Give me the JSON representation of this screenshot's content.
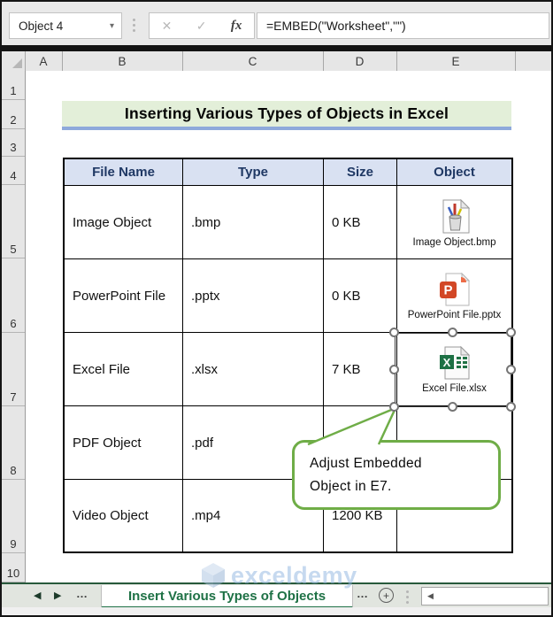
{
  "formula_bar": {
    "name_box_value": "Object 4",
    "name_box_dropdown_glyph": "▾",
    "cancel_glyph": "✕",
    "enter_glyph": "✓",
    "fx_glyph": "fx",
    "formula": "=EMBED(\"Worksheet\",\"\")"
  },
  "grid": {
    "columns": [
      "A",
      "B",
      "C",
      "D",
      "E"
    ],
    "rows": [
      "1",
      "2",
      "3",
      "4",
      "5",
      "6",
      "7",
      "8",
      "9",
      "10"
    ],
    "title": "Inserting Various Types of Objects in Excel"
  },
  "table": {
    "headers": [
      "File Name",
      "Type",
      "Size",
      "Object"
    ],
    "rows": [
      {
        "file_name": "Image Object",
        "type": ".bmp",
        "size": "0 KB",
        "object_label": "Image Object.bmp",
        "icon": "bmp-object-icon"
      },
      {
        "file_name": "PowerPoint File",
        "type": ".pptx",
        "size": "0 KB",
        "object_label": "PowerPoint File.pptx",
        "icon": "powerpoint-object-icon"
      },
      {
        "file_name": "Excel File",
        "type": ".xlsx",
        "size": "7 KB",
        "object_label": "Excel File.xlsx",
        "icon": "excel-object-icon",
        "selected": true
      },
      {
        "file_name": "PDF Object",
        "type": ".pdf",
        "size": "",
        "object_label": ""
      },
      {
        "file_name": "Video Object",
        "type": ".mp4",
        "size": "1200 KB",
        "object_label": ""
      }
    ]
  },
  "callout": {
    "line1": "Adjust Embedded",
    "line2": "Object in E7."
  },
  "tab_bar": {
    "nav_left_glyph": "◀",
    "nav_right_glyph": "▶",
    "ellipsis_left": "…",
    "active_tab": "Insert Various Types of Objects",
    "ellipsis_right": "…",
    "add_sheet_glyph": "+",
    "scroll_left_glyph": "◀",
    "watermark": "exceldemy"
  },
  "colors": {
    "excel_green": "#1e7145",
    "callout_green": "#70ad47",
    "banner_fill": "#e2efda",
    "banner_underline": "#8ea9db",
    "table_header_fill": "#d9e1f2",
    "table_header_text": "#1f3864",
    "watermark_blue": "#8fb4e0"
  }
}
